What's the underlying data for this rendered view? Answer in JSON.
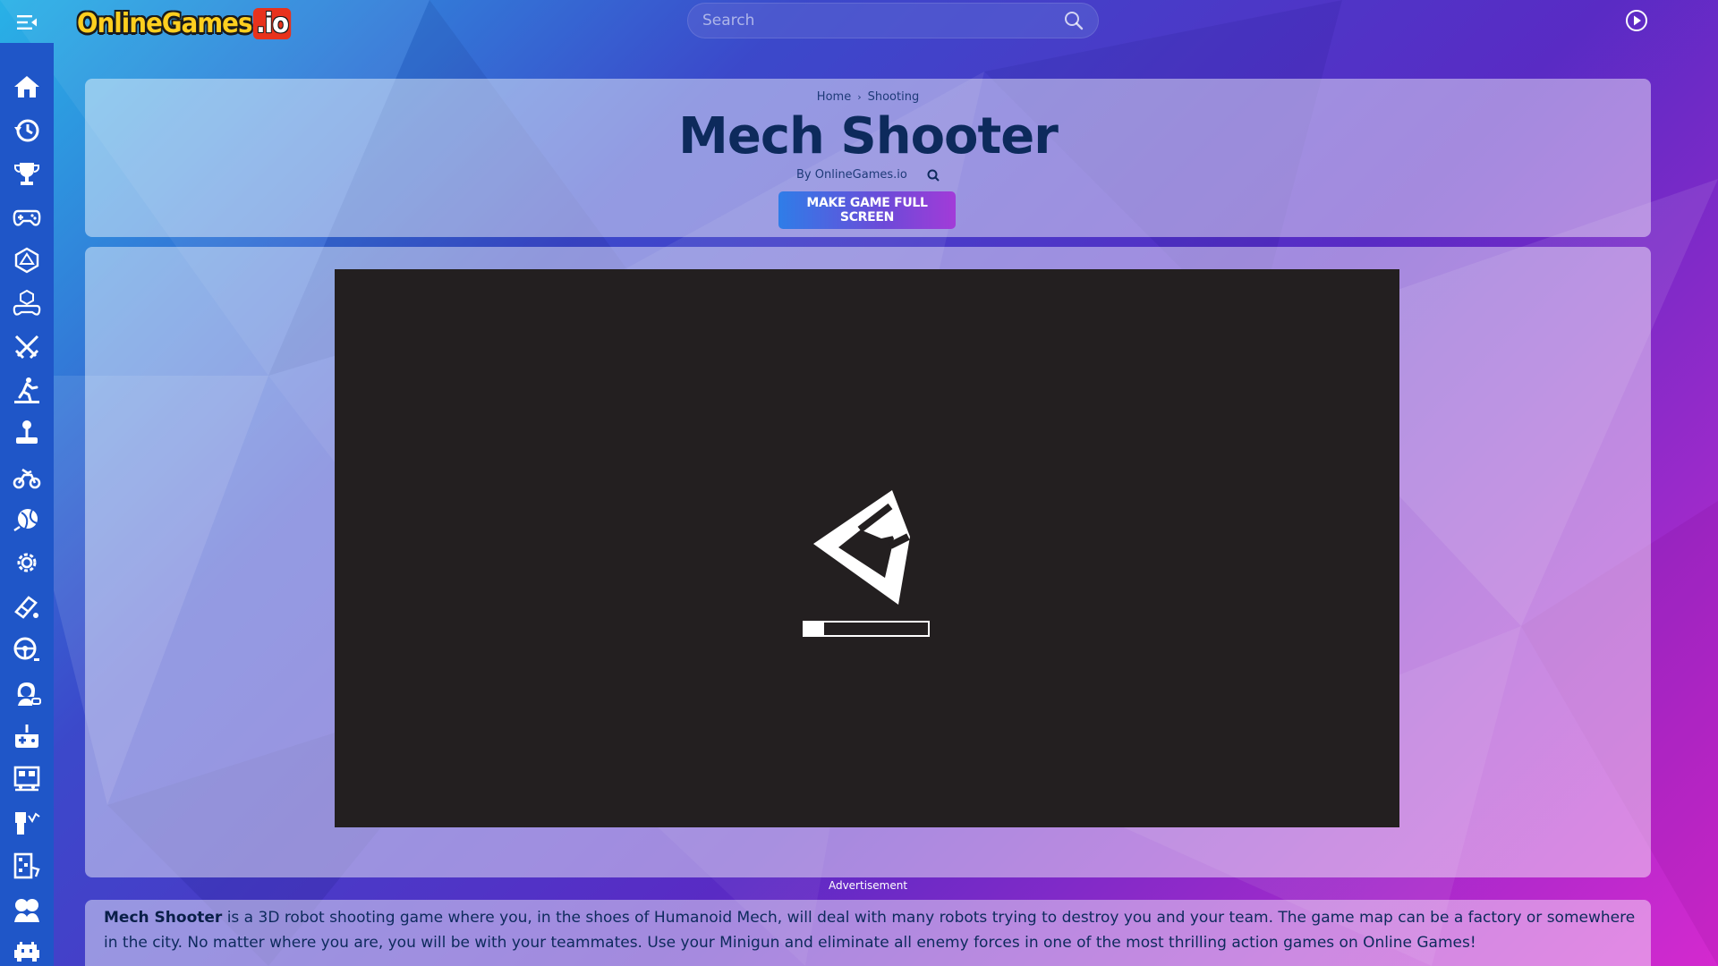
{
  "site": {
    "logo_main": "OnlineGames",
    "logo_suffix": ".io"
  },
  "search": {
    "placeholder": "Search",
    "value": ""
  },
  "sidebar": {
    "items": [
      {
        "icon": "home-icon"
      },
      {
        "icon": "history-icon"
      },
      {
        "icon": "trophy-icon"
      },
      {
        "icon": "gamepad-icon"
      },
      {
        "icon": "dice-icon"
      },
      {
        "icon": "cube-controller-icon"
      },
      {
        "icon": "crossed-swords-icon"
      },
      {
        "icon": "runner-icon"
      },
      {
        "icon": "joystick-icon"
      },
      {
        "icon": "motorbike-icon"
      },
      {
        "icon": "ball-icon"
      },
      {
        "icon": "gear-icon"
      },
      {
        "icon": "skate-icon"
      },
      {
        "icon": "steering-wheel-icon"
      },
      {
        "icon": "girl-icon"
      },
      {
        "icon": "retro-controller-icon"
      },
      {
        "icon": "train-icon"
      },
      {
        "icon": "builder-icon"
      },
      {
        "icon": "puzzle-board-icon"
      },
      {
        "icon": "couple-icon"
      },
      {
        "icon": "space-invader-icon"
      }
    ]
  },
  "breadcrumb": {
    "home": "Home",
    "separator": "›",
    "category": "Shooting"
  },
  "game": {
    "title": "Mech Shooter",
    "byline": "By OnlineGames.io",
    "fullscreen_button": "MAKE GAME FULL SCREEN",
    "loading_progress": 0.16
  },
  "advertisement_label": "Advertisement",
  "description": {
    "game_name": "Mech Shooter",
    "text": " is a 3D robot shooting game where you, in the shoes of Humanoid Mech, will deal with many robots trying to destroy you and your team. The game map can be a factory or somewhere in the city. No matter where you are, you will be with your teammates. Use your Minigun and eliminate all enemy forces in one of the most thrilling action games on Online Games!"
  },
  "colors": {
    "sidebar": "#1f56c8",
    "title": "#0d2a5c",
    "game_frame": "#231f20",
    "button_gradient_start": "#2f7de8",
    "button_gradient_end": "#a23bd8"
  }
}
